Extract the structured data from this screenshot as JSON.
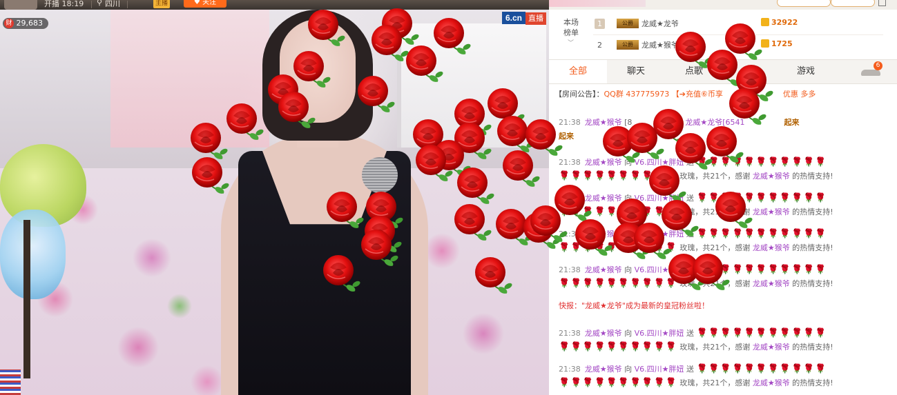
{
  "topbar": {
    "time_text": "开播 18:19",
    "location": "四川",
    "tag_text": "主播",
    "follow_label": "关注"
  },
  "wealth": {
    "icon": "财",
    "value": "29,683"
  },
  "watermark": {
    "logo": "6.cn",
    "live": "直播"
  },
  "rank": {
    "label_line1": "本场",
    "label_line2": "榜单",
    "rows": [
      {
        "num": "1",
        "badge": "公爵",
        "name": "龙威★龙爷",
        "coins": "32922"
      },
      {
        "num": "2",
        "badge": "公爵",
        "name": "龙威★猴爷",
        "coins": "1725"
      }
    ]
  },
  "tabs": [
    "全部",
    "聊天",
    "点歌",
    "",
    "游戏"
  ],
  "car_count": "6",
  "announce": {
    "label": "【房间公告】：",
    "text": "QQ群 437775973 【➔充值⑥币享",
    "tail": "优惠 多多"
  },
  "chat": {
    "time": "21:38",
    "sender": "龙威★猴爷",
    "to": "向",
    "recipient_level": "V6.",
    "recipient": "四川★胖妞",
    "send": "送",
    "roses_line1": "🌹🌹🌹🌹🌹🌹🌹🌹🌹🌹🌹",
    "roses_line2": "🌹🌹🌹🌹🌹🌹🌹🌹🌹🌹",
    "thanks_prefix": "玫瑰，共21个，感谢",
    "thanks_suffix": "的热情支持!",
    "first_msg_user": "龙威★猴爷",
    "first_msg_level": "[8",
    "first_msg_target": "龙威★龙爷[6541",
    "first_msg_tail": "起来",
    "first_msg_line2": "起来",
    "flash": "快报：\"龙威★龙爷\"成为最新的皇冠粉丝啦！"
  },
  "colors": {
    "accent": "#f25a1a",
    "username": "#a347c4",
    "rose": "#d21818",
    "flash": "#e03030"
  }
}
